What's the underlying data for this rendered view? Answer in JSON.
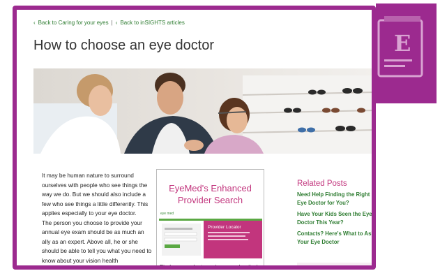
{
  "breadcrumbs": [
    {
      "label": "Back to Caring for your eyes"
    },
    {
      "label": "Back to inSIGHTS articles"
    }
  ],
  "breadcrumb_separator": "|",
  "page_title": "How to choose an eye doctor",
  "article_paragraphs": [
    "It may be human nature to surround ourselves with people who see things the way we do. But we should also include a few who see things a little differently. This applies especially to your eye doctor.",
    "The person you choose to provide your annual eye exam should be as much an ally as an expert. Above all, he or she should be able to tell you what you need to know about your vision health"
  ],
  "promo": {
    "title": "EyeMed's Enhanced Provider Search",
    "screenshot_panel_title": "Provider Locator",
    "caption": "Find an eye doctor using search criteria most important to you"
  },
  "related_posts": {
    "heading": "Related Posts",
    "items": [
      "Need Help Finding the Right Eye Doctor for You?",
      "Have Your Kids Seen the Eye Doctor This Year?",
      "Contacts? Here's What to Ask Your Eye Doctor"
    ]
  },
  "colors": {
    "frame": "#9c2a8f",
    "link_green": "#2f7d32",
    "heading_pink": "#c2357d"
  },
  "icons": {
    "breadcrumb": "chevron-left-icon",
    "badge": "eye-chart-icon"
  }
}
